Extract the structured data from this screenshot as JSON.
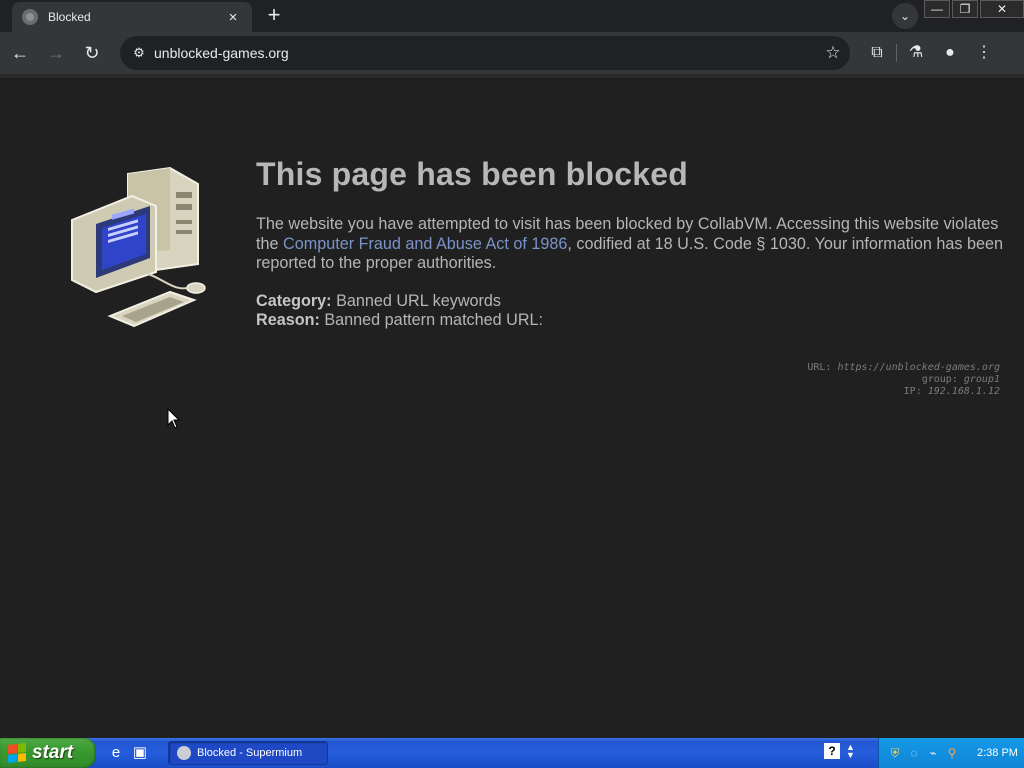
{
  "browser": {
    "tab_title": "Blocked",
    "tab_close": "×",
    "new_tab": "+",
    "tab_search": "⌄",
    "window_controls": {
      "minimize": "—",
      "restore": "❐",
      "close": "✕"
    },
    "url": "unblocked-games.org",
    "nav": {
      "back": "←",
      "forward": "→",
      "reload": "↻"
    },
    "site_info": "⚙",
    "bookmark": "☆",
    "extensions": "⧉",
    "labs": "⚗",
    "profile": "●",
    "menu": "⋮"
  },
  "page": {
    "headline": "This page has been blocked",
    "desc_part1": "The website you have attempted to visit has been blocked by CollabVM. Accessing this website violates the ",
    "desc_link": "Computer Fraud and Abuse Act of 1986",
    "desc_part2": ", codified at 18 U.S. Code § 1030. Your information has been reported to the proper authorities.",
    "category_label": "Category:",
    "category_value": "Banned URL keywords",
    "reason_label": "Reason:",
    "reason_value": "Banned pattern matched URL:",
    "debug": {
      "url_label": "URL:",
      "url_value": "https://unblocked-games.org",
      "group_label": "group:",
      "group_value": "group1",
      "ip_label": "IP:",
      "ip_value": "192.168.1.12"
    }
  },
  "taskbar": {
    "start_label": "start",
    "ql_ie": "e",
    "ql_desktop": "▣",
    "task_label": "Blocked - Supermium",
    "help": "?",
    "time": "2:38 PM"
  },
  "colors": {
    "page_bg": "#202020",
    "headline": "#b7b7b7",
    "link": "#7a93c8",
    "taskbar_blue": "#245ddb",
    "start_green": "#3a9a31"
  },
  "icons": [
    "tab-favicon-icon",
    "close-icon",
    "plus-icon",
    "chevron-down-icon",
    "back-arrow-icon",
    "forward-arrow-icon",
    "reload-icon",
    "site-info-icon",
    "star-icon",
    "extensions-icon",
    "labs-flask-icon",
    "profile-icon",
    "kebab-menu-icon",
    "computer-illustration-icon",
    "mouse-cursor-icon",
    "windows-logo-icon",
    "internet-explorer-icon",
    "show-desktop-icon",
    "help-icon",
    "shield-icon",
    "network-icon",
    "search-icon"
  ]
}
